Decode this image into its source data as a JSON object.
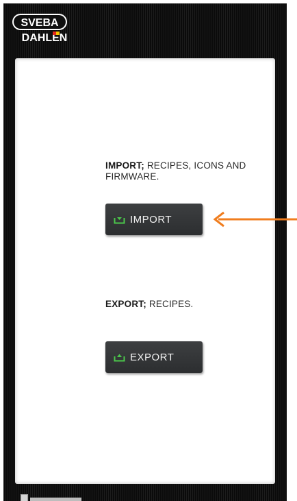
{
  "logo": {
    "line1": "SVEBA",
    "line2": "DAHLEN",
    "icon": "sveba-dahlen-logo"
  },
  "import_section": {
    "title": "IMPORT;",
    "description": " RECIPES, ICONS AND FIRMWARE.",
    "button_label": "IMPORT",
    "button_icon": "import-tray-icon"
  },
  "export_section": {
    "title": "EXPORT;",
    "description": " RECIPES.",
    "button_label": "EXPORT",
    "button_icon": "export-tray-icon"
  },
  "annotation": {
    "arrow_icon": "left-arrow-icon",
    "arrow_color": "#f07d1e"
  },
  "colors": {
    "button_bg": "#333537",
    "icon_green": "#4bc84b",
    "device_bg": "#0f0f0f",
    "screen_bg": "#ffffff"
  }
}
